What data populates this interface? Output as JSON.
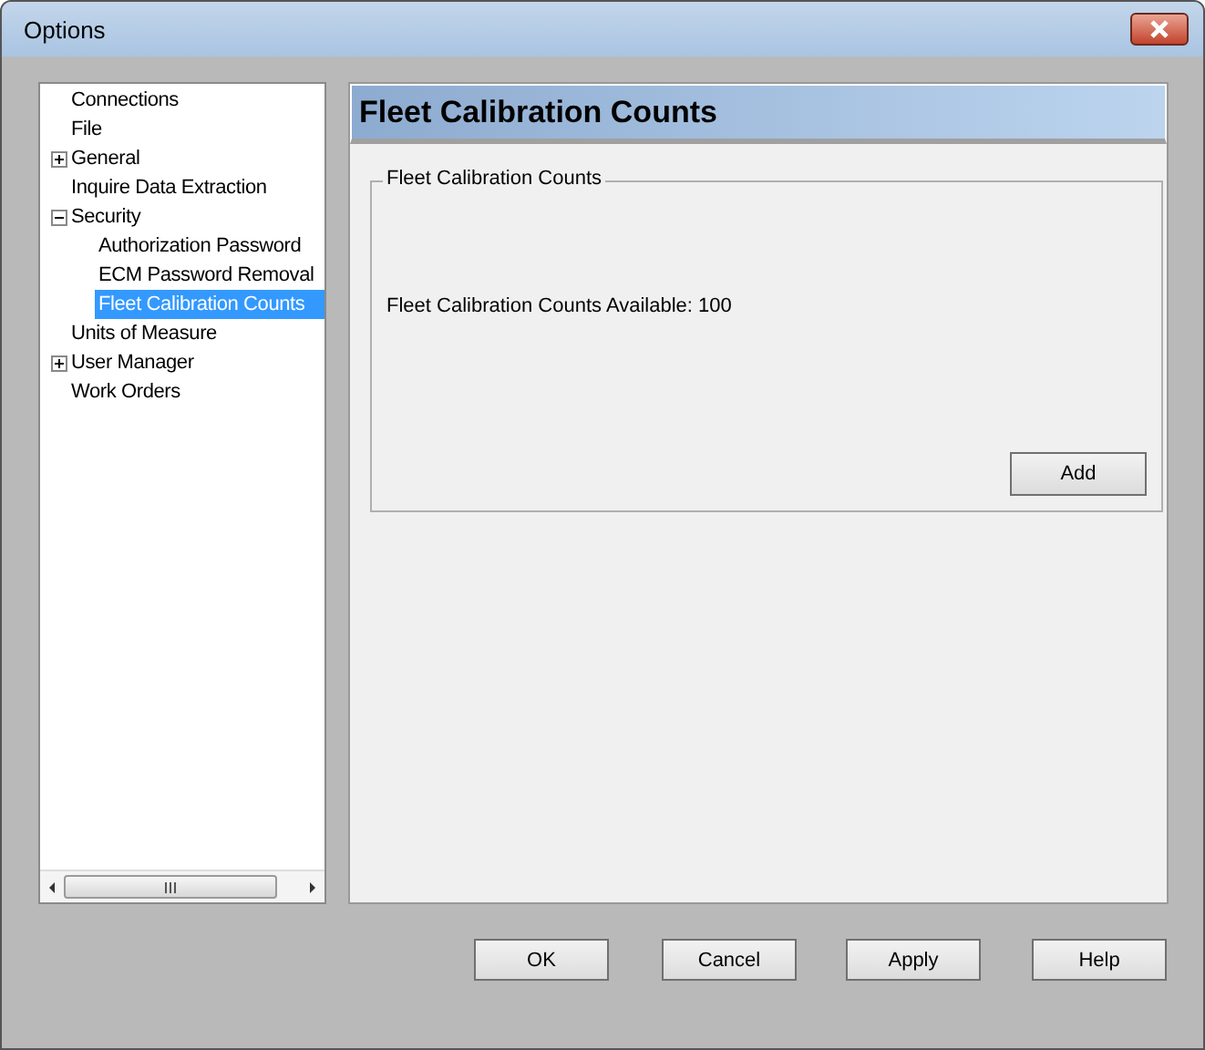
{
  "window": {
    "title": "Options"
  },
  "tree": {
    "items": [
      {
        "label": "Connections",
        "kind": "leaf",
        "selected": false
      },
      {
        "label": "File",
        "kind": "leaf",
        "selected": false
      },
      {
        "label": "General",
        "kind": "group",
        "expanded": false,
        "selected": false
      },
      {
        "label": "Inquire Data Extraction",
        "kind": "leaf",
        "selected": false
      },
      {
        "label": "Security",
        "kind": "group",
        "expanded": true,
        "selected": false,
        "children": [
          {
            "label": "Authorization Password",
            "selected": false
          },
          {
            "label": "ECM Password Removal",
            "selected": false
          },
          {
            "label": "Fleet Calibration Counts",
            "selected": true
          }
        ]
      },
      {
        "label": "Units of Measure",
        "kind": "leaf",
        "selected": false
      },
      {
        "label": "User Manager",
        "kind": "group",
        "expanded": false,
        "selected": false
      },
      {
        "label": "Work Orders",
        "kind": "leaf",
        "selected": false
      }
    ]
  },
  "panel": {
    "header": "Fleet Calibration Counts",
    "group_title": "Fleet Calibration Counts",
    "info": "Fleet Calibration Counts Available: 100",
    "add_button": "Add"
  },
  "buttons": [
    "OK",
    "Cancel",
    "Apply",
    "Help"
  ]
}
